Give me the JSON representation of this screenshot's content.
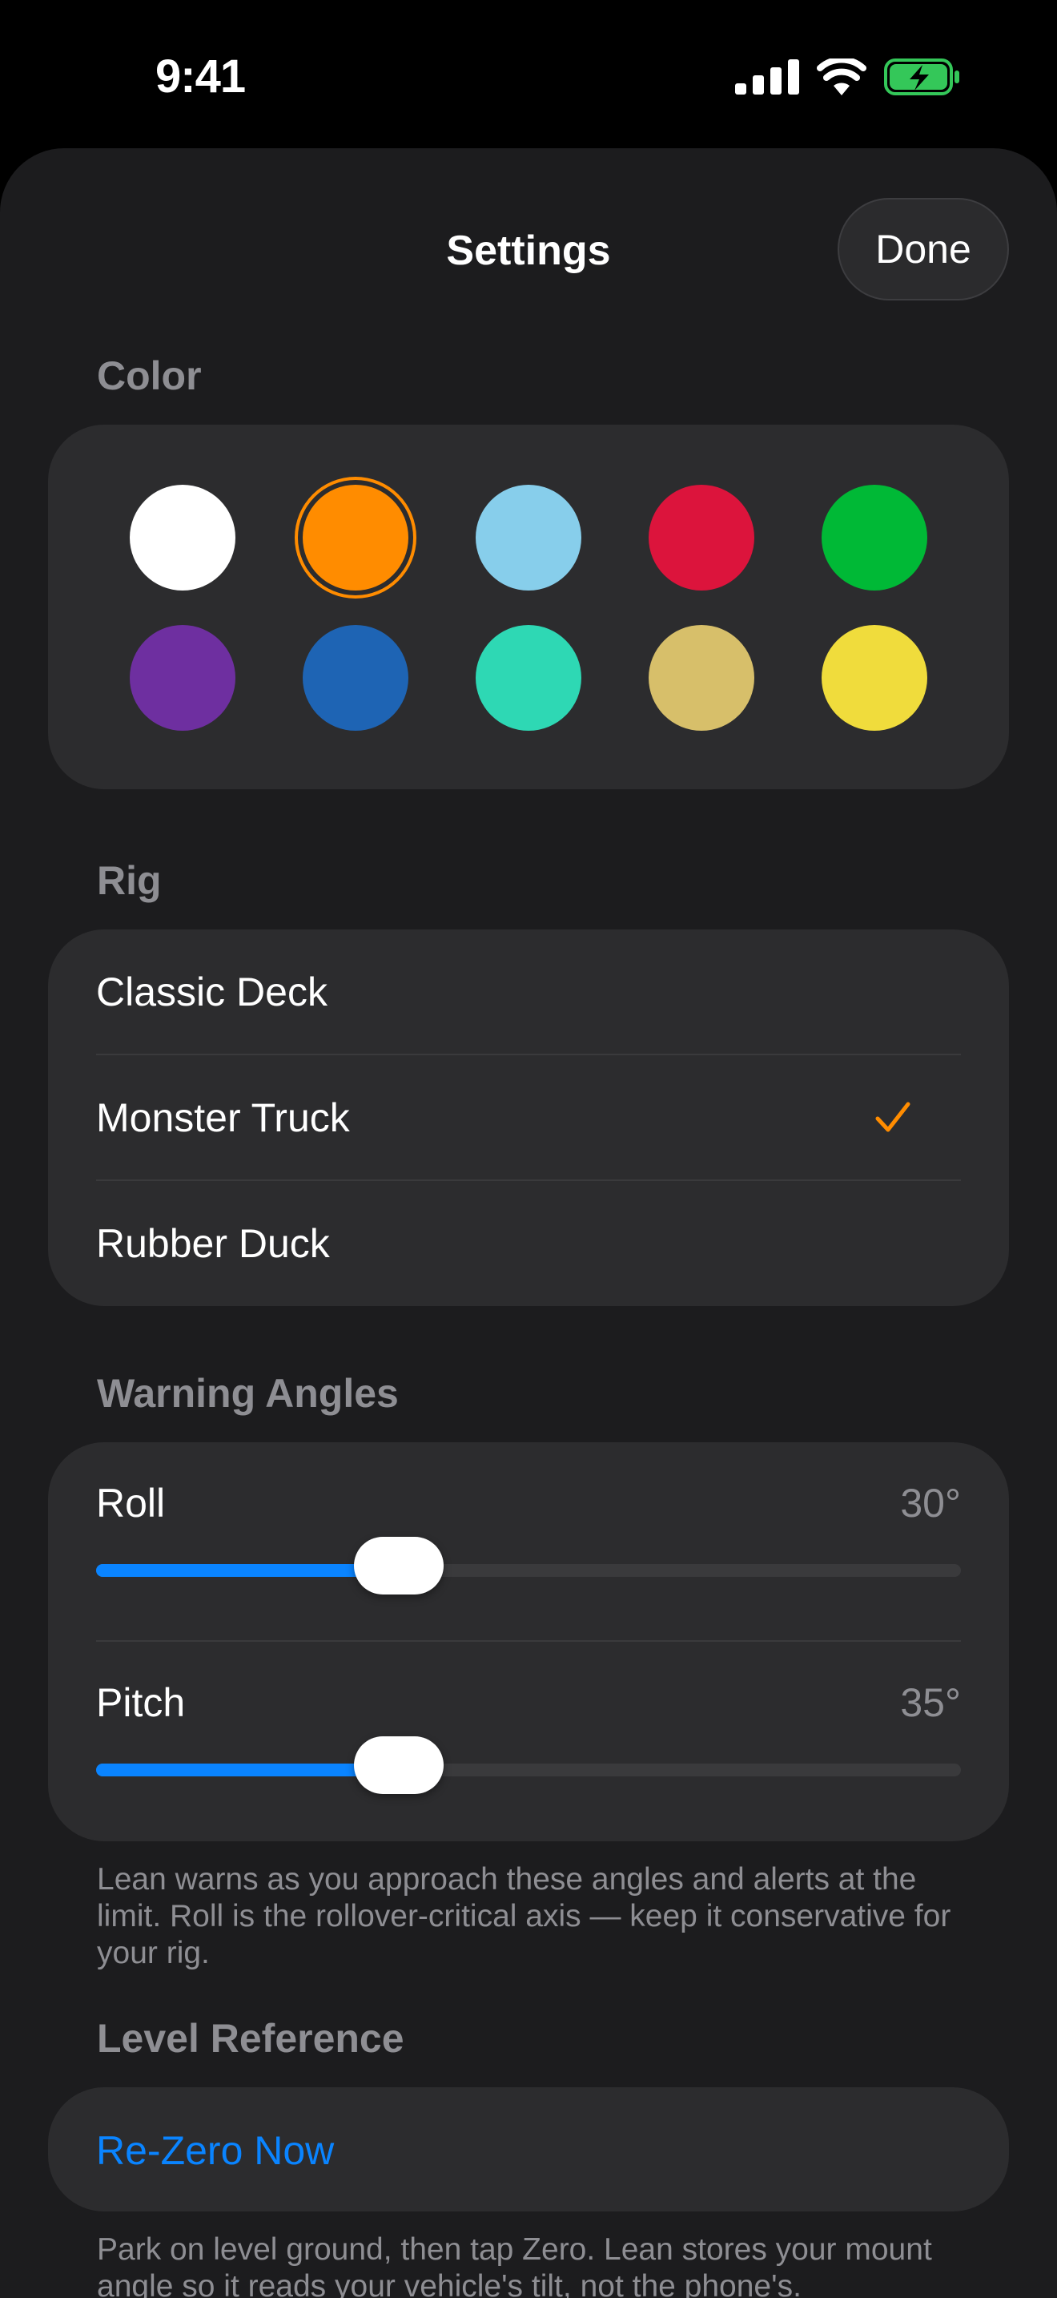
{
  "status_bar": {
    "time": "9:41",
    "icons": [
      "cellular-signal-icon",
      "wifi-icon",
      "battery-charging-icon"
    ],
    "battery_color": "#34c759"
  },
  "sheet": {
    "title": "Settings",
    "done_label": "Done"
  },
  "color_section": {
    "header": "Color",
    "selected": "orange",
    "swatches": [
      {
        "name": "white",
        "color": "#ffffff"
      },
      {
        "name": "orange",
        "color": "#ff8c00"
      },
      {
        "name": "light-blue",
        "color": "#87ceeb"
      },
      {
        "name": "red",
        "color": "#dc143c"
      },
      {
        "name": "green",
        "color": "#00b936"
      },
      {
        "name": "purple",
        "color": "#6e2fa0"
      },
      {
        "name": "blue",
        "color": "#1e64b4"
      },
      {
        "name": "teal",
        "color": "#2ed8b4"
      },
      {
        "name": "tan",
        "color": "#d7bf6a"
      },
      {
        "name": "yellow",
        "color": "#f0dc3c"
      }
    ]
  },
  "rig_section": {
    "header": "Rig",
    "items": [
      {
        "label": "Classic Deck",
        "selected": false
      },
      {
        "label": "Monster Truck",
        "selected": true
      },
      {
        "label": "Rubber Duck",
        "selected": false
      }
    ],
    "check_glyph": "✓"
  },
  "warning_section": {
    "header": "Warning Angles",
    "sliders": [
      {
        "label": "Roll",
        "value_text": "30°",
        "fraction": 0.35
      },
      {
        "label": "Pitch",
        "value_text": "35°",
        "fraction": 0.35
      }
    ],
    "footnote": "Lean warns as you approach these angles and alerts at the limit. Roll is the rollover-critical axis — keep it conservative for your rig."
  },
  "level_section": {
    "header": "Level Reference",
    "action_label": "Re-Zero Now",
    "footnote": "Park on level ground, then tap Zero. Lean stores your mount angle so it reads your vehicle's tilt, not the phone's."
  },
  "accent_color": "#0a84ff",
  "selection_color": "#ff8c00"
}
